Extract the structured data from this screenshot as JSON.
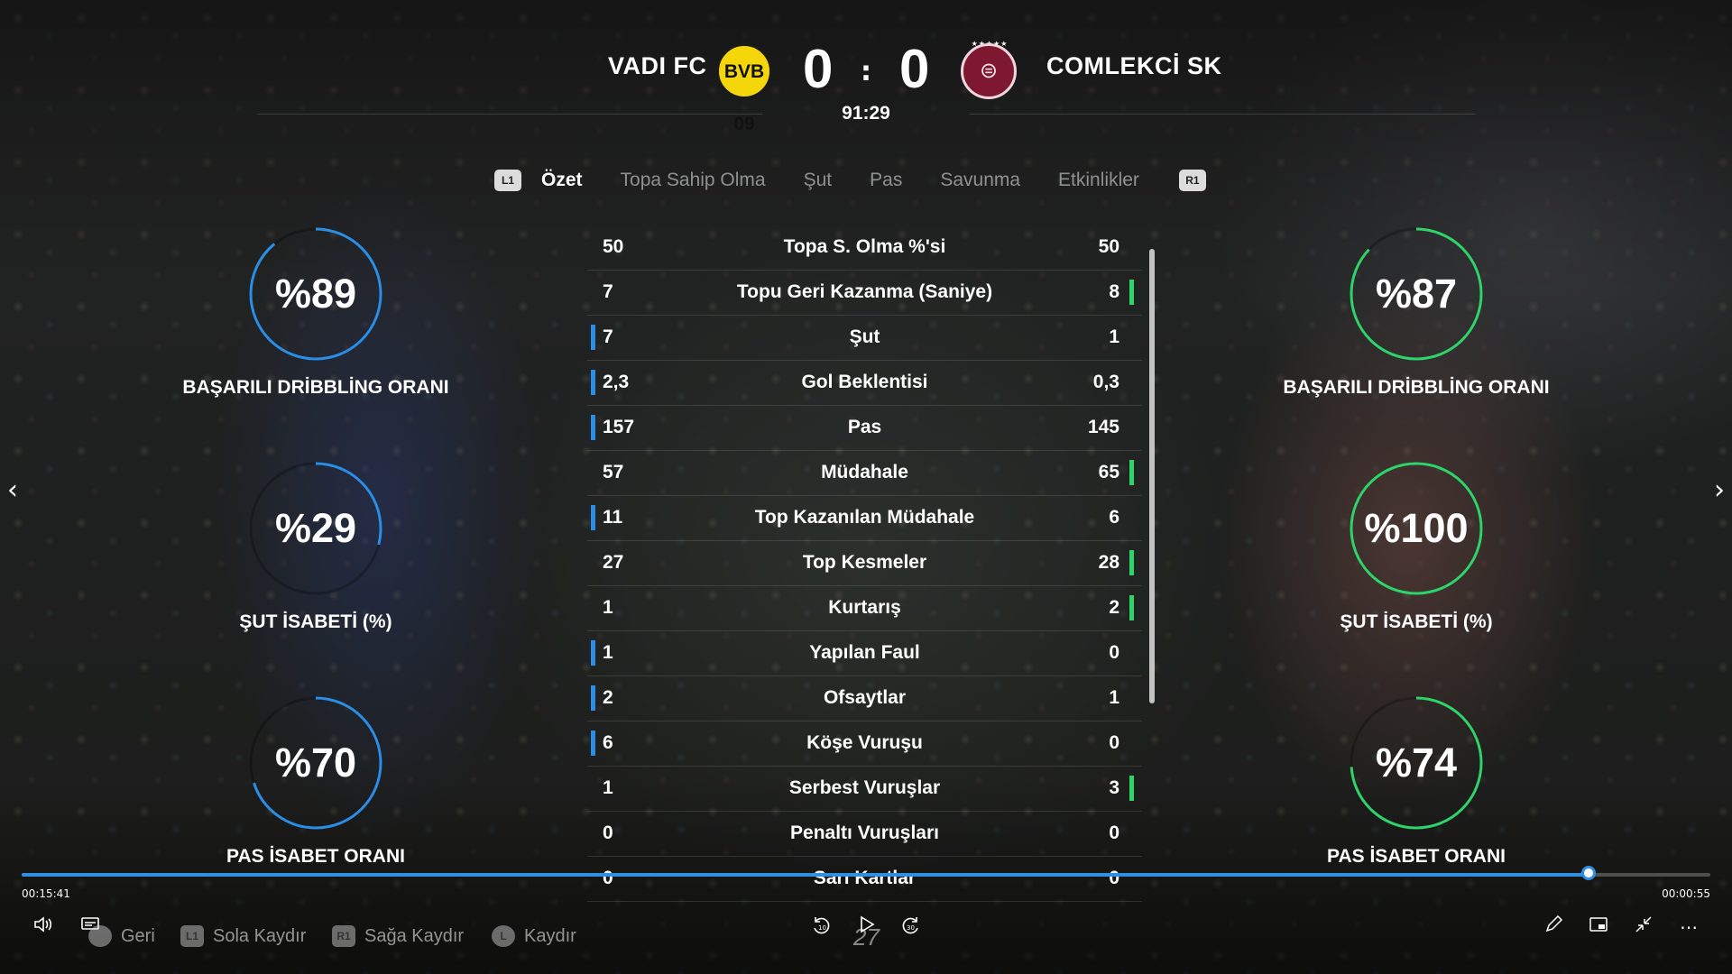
{
  "match": {
    "home_team": "VADI FC",
    "away_team": "COMLEKCİ SK",
    "home_crest_text": "BVB 09",
    "away_crest_text": "⊜",
    "away_crest_stars": "★★★★★",
    "home_score": "0",
    "score_separator": ":",
    "away_score": "0",
    "clock": "91:29"
  },
  "tabs": {
    "left_shoulder": "L1",
    "right_shoulder": "R1",
    "items": [
      "Özet",
      "Topa Sahip Olma",
      "Şut",
      "Pas",
      "Savunma",
      "Etkinlikler"
    ]
  },
  "colors": {
    "home_accent": "#2a8ee6",
    "away_accent": "#2ed36a"
  },
  "home_rings": [
    {
      "value": "%89",
      "percent": 89,
      "label": "BAŞARILI DRİBBLİNG ORANI"
    },
    {
      "value": "%29",
      "percent": 29,
      "label": "ŞUT İSABETİ (%)"
    },
    {
      "value": "%70",
      "percent": 70,
      "label": "PAS İSABET ORANI"
    }
  ],
  "away_rings": [
    {
      "value": "%87",
      "percent": 87,
      "label": "BAŞARILI DRİBBLİNG ORANI"
    },
    {
      "value": "%100",
      "percent": 100,
      "label": "ŞUT İSABETİ (%)"
    },
    {
      "value": "%74",
      "percent": 74,
      "label": "PAS İSABET ORANI"
    }
  ],
  "stats": [
    {
      "home": "50",
      "label": "Topa S. Olma %'si",
      "away": "50",
      "leader": "none"
    },
    {
      "home": "7",
      "label": "Topu Geri Kazanma (Saniye)",
      "away": "8",
      "leader": "away"
    },
    {
      "home": "7",
      "label": "Şut",
      "away": "1",
      "leader": "home"
    },
    {
      "home": "2,3",
      "label": "Gol Beklentisi",
      "away": "0,3",
      "leader": "home"
    },
    {
      "home": "157",
      "label": "Pas",
      "away": "145",
      "leader": "home"
    },
    {
      "home": "57",
      "label": "Müdahale",
      "away": "65",
      "leader": "away"
    },
    {
      "home": "11",
      "label": "Top Kazanılan Müdahale",
      "away": "6",
      "leader": "home"
    },
    {
      "home": "27",
      "label": "Top Kesmeler",
      "away": "28",
      "leader": "away"
    },
    {
      "home": "1",
      "label": "Kurtarış",
      "away": "2",
      "leader": "away"
    },
    {
      "home": "1",
      "label": "Yapılan Faul",
      "away": "0",
      "leader": "home"
    },
    {
      "home": "2",
      "label": "Ofsaytlar",
      "away": "1",
      "leader": "home"
    },
    {
      "home": "6",
      "label": "Köşe Vuruşu",
      "away": "0",
      "leader": "home"
    },
    {
      "home": "1",
      "label": "Serbest Vuruşlar",
      "away": "3",
      "leader": "away"
    },
    {
      "home": "0",
      "label": "Penaltı Vuruşları",
      "away": "0",
      "leader": "none"
    },
    {
      "home": "0",
      "label": "Sarı Kartlar",
      "away": "0",
      "leader": "none"
    }
  ],
  "player": {
    "elapsed": "00:15:41",
    "remaining": "00:00:55",
    "progress_fraction": 0.928,
    "subtitle_number": "27",
    "hints": [
      {
        "button": "○",
        "label": "Geri"
      },
      {
        "button": "L1",
        "label": "Sola Kaydır"
      },
      {
        "button": "R1",
        "label": "Sağa Kaydır"
      },
      {
        "button": "L",
        "label": "Kaydır"
      }
    ],
    "icons": [
      "volume-icon",
      "captions-icon",
      "rewind-10-icon",
      "play-icon",
      "forward-30-icon",
      "pen-icon",
      "miniplayer-icon",
      "collapse-icon",
      "more-icon"
    ]
  }
}
